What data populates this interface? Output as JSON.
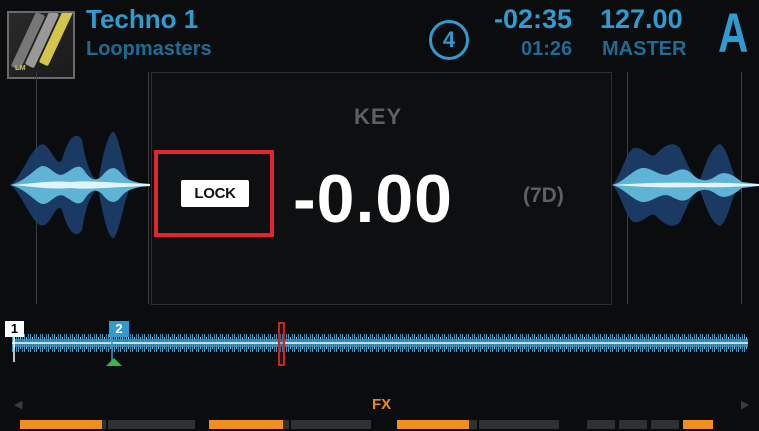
{
  "header": {
    "title": "Techno 1",
    "artist": "Loopmasters",
    "deck_number": "4",
    "time_remaining": "-02:35",
    "time_elapsed": "01:26",
    "bpm": "127.00",
    "tempo_source": "MASTER",
    "deck_letter": "A",
    "cover_logo_text": "LM"
  },
  "key_panel": {
    "heading": "KEY",
    "lock_label": "LOCK",
    "value": "-0.00",
    "key_code": "(7D)"
  },
  "overview": {
    "cue_points": [
      {
        "label": "1",
        "color": "#ffffff"
      },
      {
        "label": "2",
        "color": "#2f9bd0"
      }
    ],
    "playhead_position": 0.365
  },
  "footer": {
    "section_label": "FX",
    "left_arrow_icon": "triangle-left-icon",
    "right_arrow_icon": "triangle-right-icon",
    "slot_levels": [
      0.95,
      0,
      0.92,
      0,
      0.9,
      0,
      0,
      0,
      0,
      1.0
    ]
  },
  "colors": {
    "accent": "#2f9bd0",
    "accent_dim": "#1f6b93",
    "highlight": "#e0262b",
    "fx": "#f08f1d",
    "background": "#0b0c0d"
  }
}
